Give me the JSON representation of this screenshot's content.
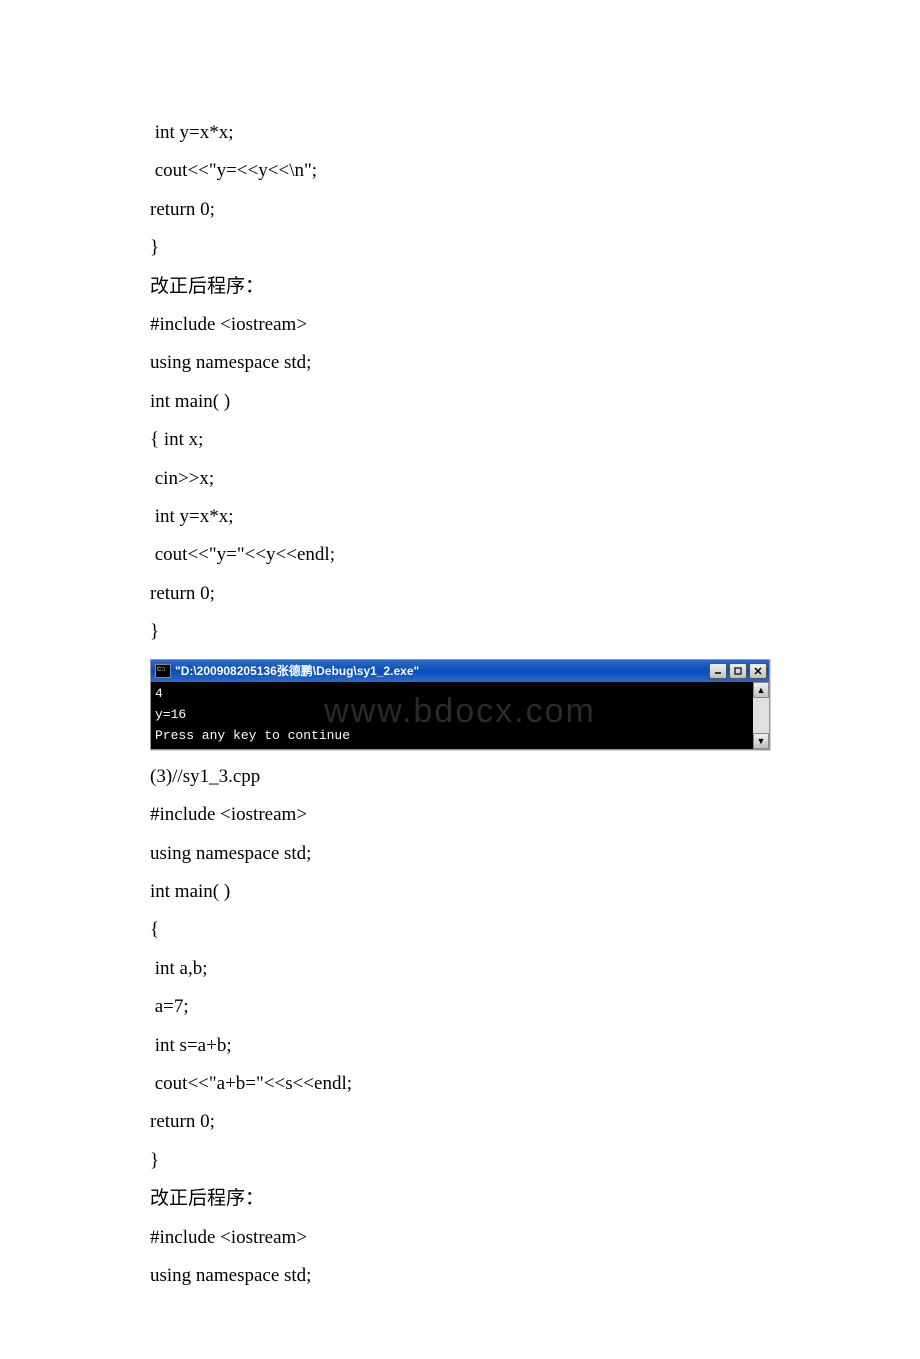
{
  "code_block1": {
    "lines": [
      " int y=x*x;",
      " cout<<\"y=<<y<<\\n\";",
      "return 0;",
      "}"
    ]
  },
  "corrected_label": "改正后程序：",
  "code_block2": {
    "lines": [
      "#include <iostream>",
      "using namespace std;",
      "int main( )",
      "{ int x;",
      " cin>>x;",
      " int y=x*x;",
      " cout<<\"y=\"<<y<<endl;",
      "return 0;",
      "}"
    ]
  },
  "console": {
    "title": "\"D:\\200908205136张德鹏\\Debug\\sy1_2.exe\"",
    "lines": [
      "4",
      "y=16",
      "Press any key to continue"
    ],
    "watermark": "www.bdocx.com"
  },
  "section3_label": "(3)//sy1_3.cpp",
  "code_block3": {
    "lines": [
      "#include <iostream>",
      "using namespace std;",
      "int main( )",
      "{",
      " int a,b;",
      " a=7;",
      " int s=a+b;",
      " cout<<\"a+b=\"<<s<<endl;",
      "return 0;",
      "}"
    ]
  },
  "corrected_label2": "改正后程序：",
  "code_block4": {
    "lines": [
      "#include <iostream>",
      "using namespace std;"
    ]
  }
}
